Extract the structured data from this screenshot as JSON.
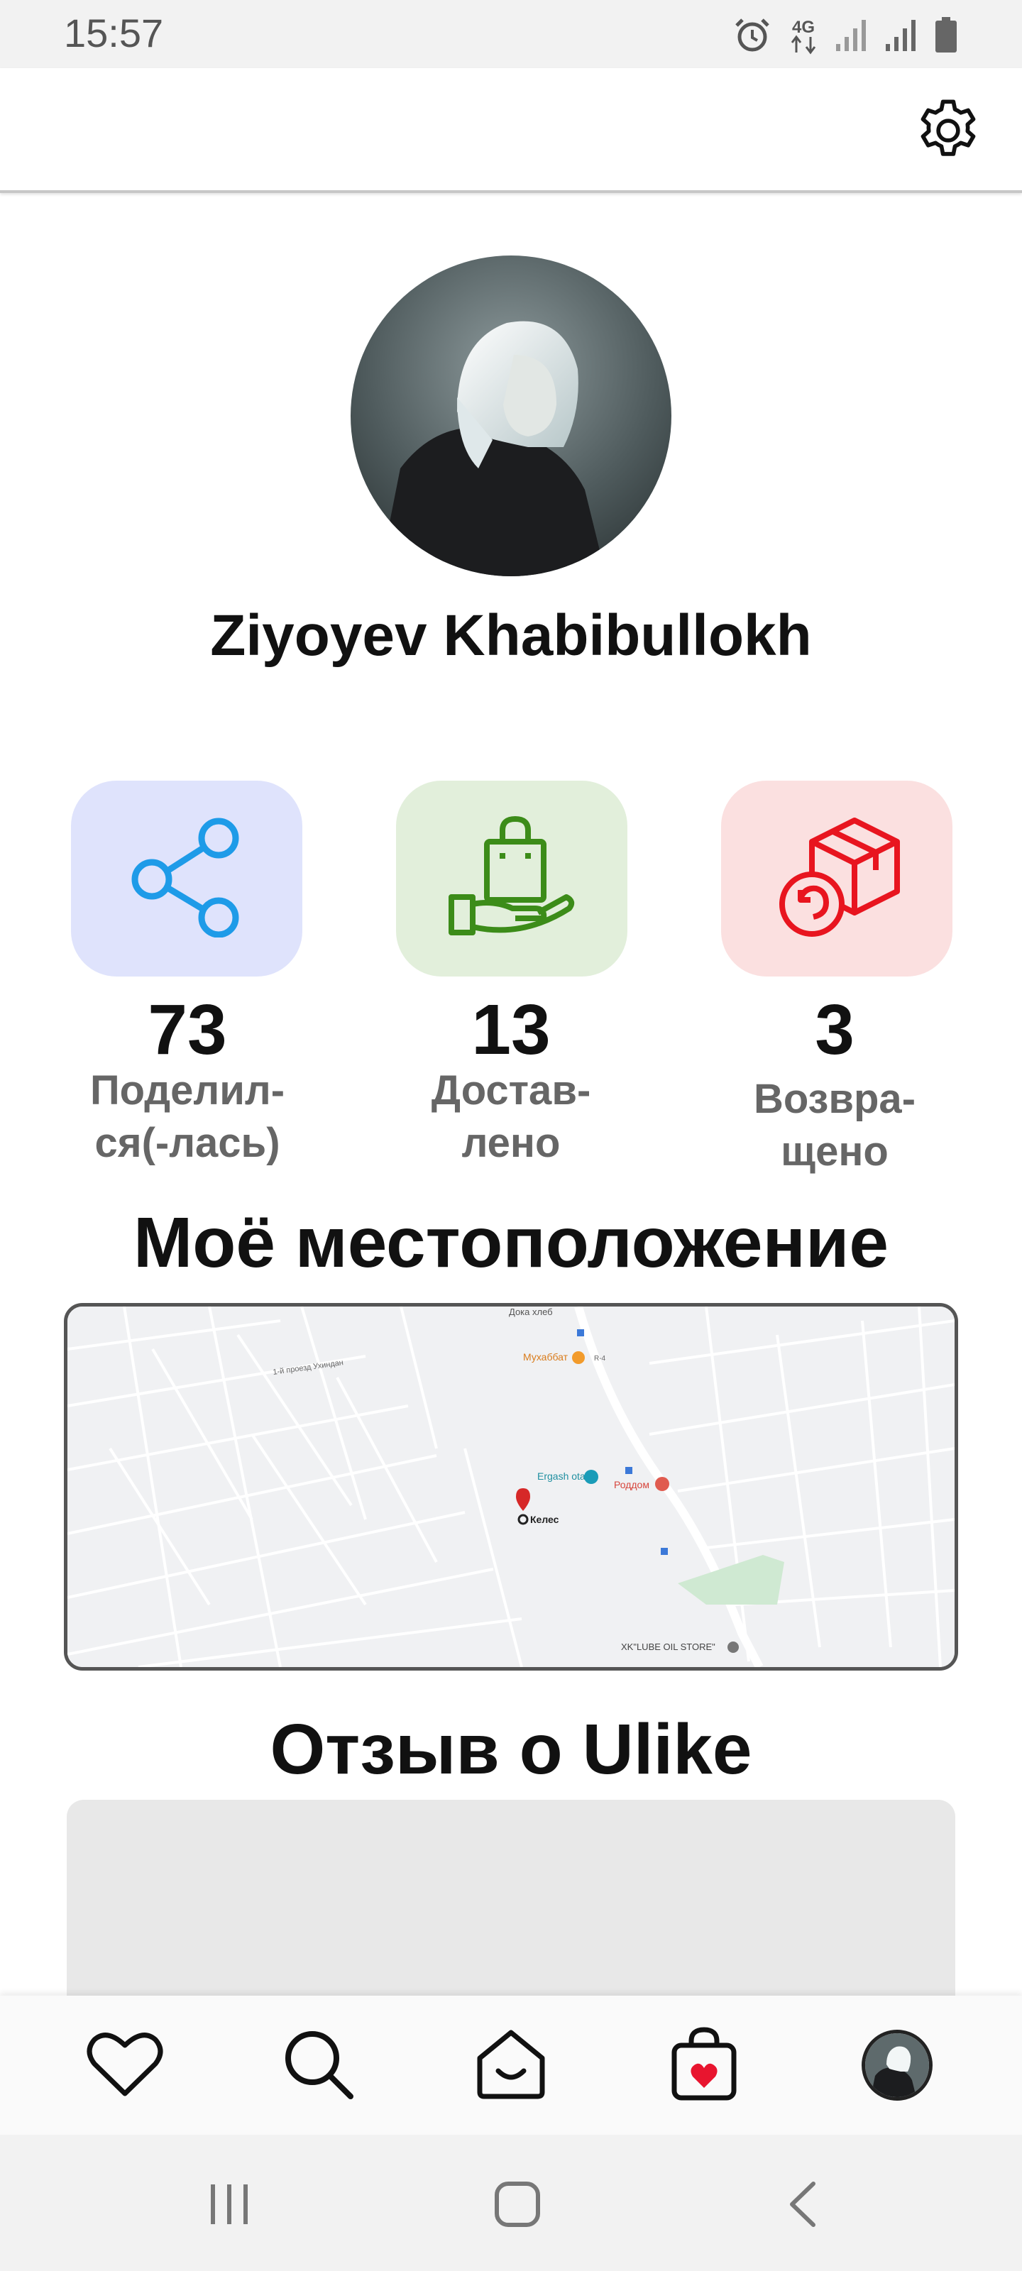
{
  "status_bar": {
    "time": "15:57",
    "network": "4G",
    "icons": [
      "alarm-icon",
      "4g-icon",
      "signal-icon",
      "signal-icon",
      "battery-icon"
    ]
  },
  "app_bar": {
    "settings_icon": "gear-icon"
  },
  "profile": {
    "name": "Ziyoyev Khabibullokh"
  },
  "stats": [
    {
      "icon": "share-icon",
      "value": "73",
      "label": "Поделил-\nся(-лась)",
      "bg": "#dfe3fc",
      "accent": "#1e9be8"
    },
    {
      "icon": "delivered-bag-icon",
      "value": "13",
      "label": "Достав-\nлено",
      "bg": "#e2efdb",
      "accent": "#3c8c19"
    },
    {
      "icon": "return-box-icon",
      "value": "3",
      "label": "Возвра-\nщено",
      "bg": "#fbe0e0",
      "accent": "#e8151f"
    }
  ],
  "location": {
    "title": "Моё местоположение",
    "map_labels": {
      "top_shop": "Дока хлеб",
      "street": "1-й проезд Ухиндан",
      "restaurant": "Мухаббат",
      "bus_stop": "Ergash ota",
      "maternity": "Роддом",
      "pin": "Келес",
      "store": "XK\"LUBE OIL STORE\"",
      "road": "R-4"
    }
  },
  "review": {
    "title": "Отзыв о Ulike"
  },
  "bottom_nav": {
    "items": [
      "heart-icon",
      "search-icon",
      "home-icon",
      "cart-icon",
      "profile-avatar"
    ]
  },
  "system_nav": {
    "items": [
      "recent-apps-icon",
      "home-button-icon",
      "back-icon"
    ]
  }
}
